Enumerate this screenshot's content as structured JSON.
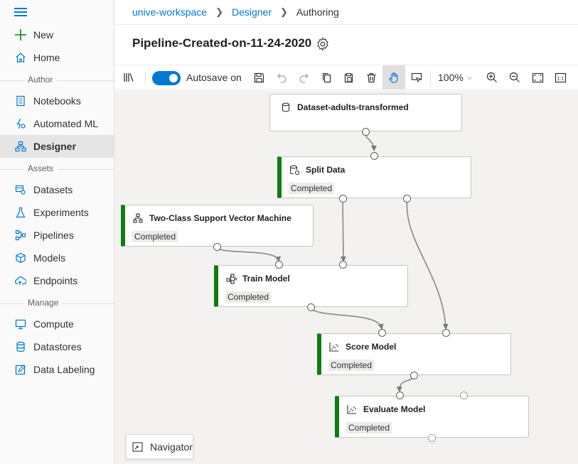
{
  "sidebar": {
    "new_label": "New",
    "home_label": "Home",
    "section_author": "Author",
    "notebooks_label": "Notebooks",
    "automl_label": "Automated ML",
    "designer_label": "Designer",
    "section_assets": "Assets",
    "datasets_label": "Datasets",
    "experiments_label": "Experiments",
    "pipelines_label": "Pipelines",
    "models_label": "Models",
    "endpoints_label": "Endpoints",
    "section_manage": "Manage",
    "compute_label": "Compute",
    "datastores_label": "Datastores",
    "datalabeling_label": "Data Labeling",
    "active_item": "Designer"
  },
  "breadcrumb": {
    "workspace": "unive-workspace",
    "designer": "Designer",
    "current": "Authoring"
  },
  "page": {
    "title": "Pipeline-Created-on-11-24-2020"
  },
  "toolbar": {
    "autosave_label": "Autosave on",
    "autosave_on": true,
    "zoom": "100%",
    "icons": [
      "library-icon",
      "save-icon",
      "undo-icon",
      "redo-icon",
      "copy-icon",
      "paste-icon",
      "delete-icon",
      "pan-hand-icon",
      "comment-icon",
      "zoom-in-icon",
      "zoom-out-icon",
      "fit-screen-icon",
      "actual-size-icon"
    ]
  },
  "canvas": {
    "nodes": {
      "dataset": {
        "title": "Dataset-adults-transformed",
        "status": ""
      },
      "split": {
        "title": "Split Data",
        "status": "Completed"
      },
      "svm": {
        "title": "Two-Class Support Vector Machine",
        "status": "Completed"
      },
      "train": {
        "title": "Train Model",
        "status": "Completed"
      },
      "score": {
        "title": "Score Model",
        "status": "Completed"
      },
      "evaluate": {
        "title": "Evaluate Model",
        "status": "Completed"
      }
    },
    "navigator_label": "Navigator"
  },
  "colors": {
    "accent": "#0078d4",
    "completed": "#107c10",
    "canvas_bg": "#f3f2f1"
  }
}
